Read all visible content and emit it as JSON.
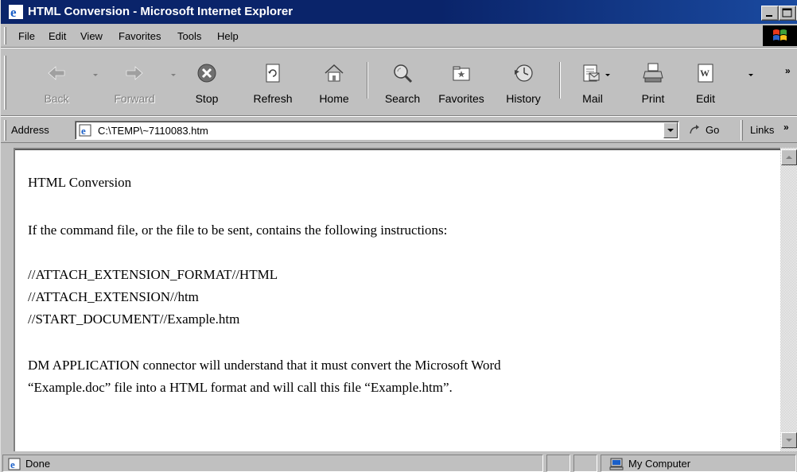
{
  "window": {
    "title": "HTML Conversion - Microsoft Internet Explorer"
  },
  "menu": {
    "items": [
      "File",
      "Edit",
      "View",
      "Favorites",
      "Tools",
      "Help"
    ]
  },
  "toolbar": {
    "back": "Back",
    "forward": "Forward",
    "stop": "Stop",
    "refresh": "Refresh",
    "home": "Home",
    "search": "Search",
    "favorites": "Favorites",
    "history": "History",
    "mail": "Mail",
    "print": "Print",
    "edit": "Edit",
    "chevron": "»"
  },
  "address": {
    "label": "Address",
    "value": "C:\\TEMP\\~7110083.htm",
    "go": "Go",
    "links": "Links",
    "chevron": "»"
  },
  "content": {
    "lines": [
      "HTML Conversion",
      "If the command file, or the file to be sent, contains the following instructions:",
      "//ATTACH_EXTENSION_FORMAT//HTML",
      "//ATTACH_EXTENSION//htm",
      "//START_DOCUMENT//Example.htm",
      "DM APPLICATION connector will understand that it must convert the Microsoft Word",
      "“Example.doc” file into a HTML format and will call this file “Example.htm”."
    ]
  },
  "status": {
    "text": "Done",
    "zone": "My Computer"
  },
  "colors": {
    "titlebar": "#0a246a",
    "chrome": "#c0c0c0"
  }
}
